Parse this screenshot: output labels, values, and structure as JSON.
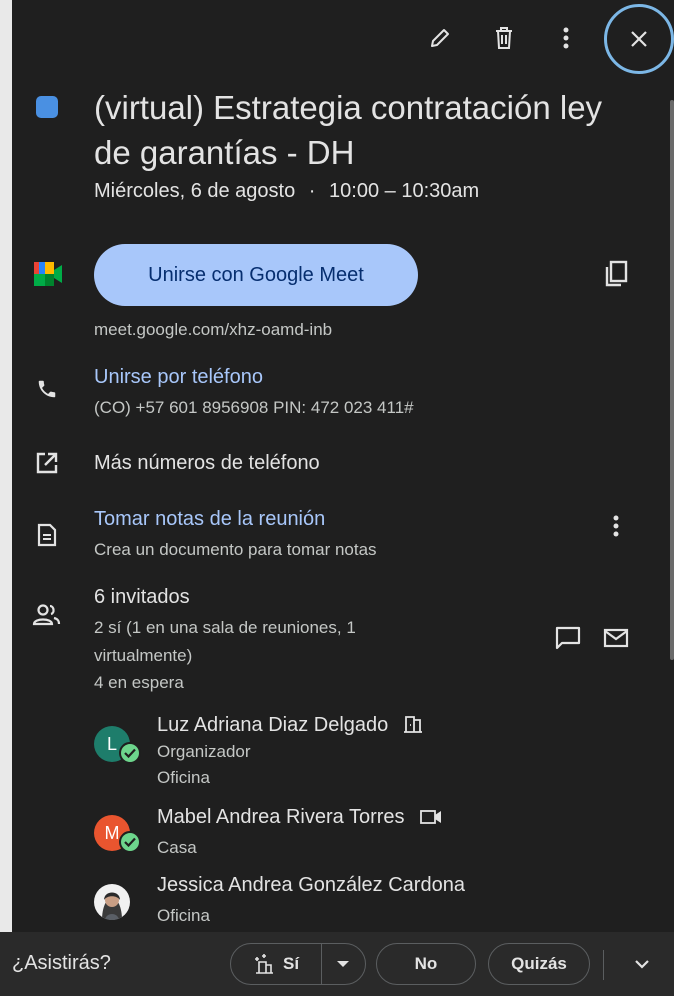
{
  "event": {
    "color": "#4a90e2",
    "title_line1": "(virtual) Estrategia contratación ley",
    "title_line2": "de garantías - DH",
    "date": "Miércoles, 6 de agosto",
    "separator": "·",
    "time": "10:00 – 10:30am"
  },
  "meet": {
    "button_label": "Unirse con Google Meet",
    "url": "meet.google.com/xhz-oamd-inb"
  },
  "phone": {
    "label": "Unirse por teléfono",
    "detail": "(CO) +57 601 8956908 PIN: 472 023 411#",
    "more_label": "Más números de teléfono"
  },
  "notes": {
    "label": "Tomar notas de la reunión",
    "sub": "Crea un documento para tomar notas"
  },
  "guests": {
    "count_label": "6 invitados",
    "yes_line1": "2 sí (1 en una sala de reuniones, 1",
    "yes_line2": "virtualmente)",
    "waiting": "4 en espera",
    "list": [
      {
        "initial": "L",
        "name": "Luz Adriana Diaz Delgado",
        "role": "Organizador",
        "location": "Oficina",
        "avatar_color": "#1e7d6b"
      },
      {
        "initial": "M",
        "name": "Mabel Andrea Rivera Torres",
        "location": "Casa",
        "avatar_color": "#e9552f"
      },
      {
        "initial": "",
        "name": "Jessica Andrea González Cardona",
        "location": "Oficina"
      }
    ]
  },
  "rsvp": {
    "question": "¿Asistirás?",
    "yes": "Sí",
    "no": "No",
    "maybe": "Quizás"
  }
}
